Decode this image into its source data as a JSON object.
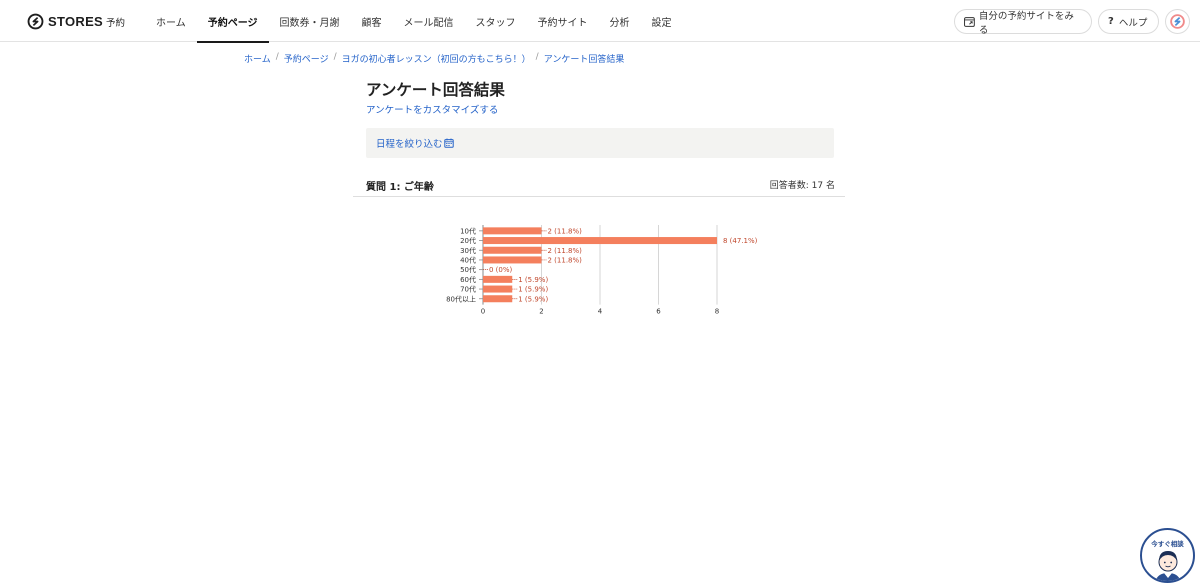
{
  "header": {
    "brand": "STORES",
    "brand_sub": "予約",
    "nav": [
      {
        "label": "ホーム",
        "active": false
      },
      {
        "label": "予約ページ",
        "active": true
      },
      {
        "label": "回数券・月謝",
        "active": false
      },
      {
        "label": "顧客",
        "active": false
      },
      {
        "label": "メール配信",
        "active": false
      },
      {
        "label": "スタッフ",
        "active": false
      },
      {
        "label": "予約サイト",
        "active": false
      },
      {
        "label": "分析",
        "active": false
      },
      {
        "label": "設定",
        "active": false
      }
    ],
    "view_site_label": "自分の予約サイトをみる",
    "help_label": "ヘルプ",
    "help_glyph": "?"
  },
  "breadcrumb": [
    "ホーム",
    "予約ページ",
    "ヨガの初心者レッスン（初回の方もこちら！）",
    "アンケート回答結果"
  ],
  "page": {
    "title": "アンケート回答結果",
    "customize_link": "アンケートをカスタマイズする",
    "filter_label": "日程を絞り込む"
  },
  "question": {
    "title": "質問 1: ご年齢",
    "respondents": "回答者数: 17 名"
  },
  "chart_data": {
    "type": "bar",
    "orientation": "horizontal",
    "categories": [
      "10代",
      "20代",
      "30代",
      "40代",
      "50代",
      "60代",
      "70代",
      "80代以上"
    ],
    "values": [
      2,
      8,
      2,
      2,
      0,
      1,
      1,
      1
    ],
    "labels": [
      "2 (11.8%)",
      "8 (47.1%)",
      "2 (11.8%)",
      "2 (11.8%)",
      "0 (0%)",
      "1 (5.9%)",
      "1 (5.9%)",
      "1 (5.9%)"
    ],
    "xticks": [
      "0",
      "2",
      "4",
      "6",
      "8"
    ],
    "xlim": [
      0,
      8
    ],
    "grid": true,
    "bar_color": "#f47f5d",
    "label_color": "#c0472c"
  },
  "chat": {
    "label": "今すぐ相談"
  },
  "colors": {
    "link": "#2563c9",
    "chat": "#2b4f91"
  }
}
